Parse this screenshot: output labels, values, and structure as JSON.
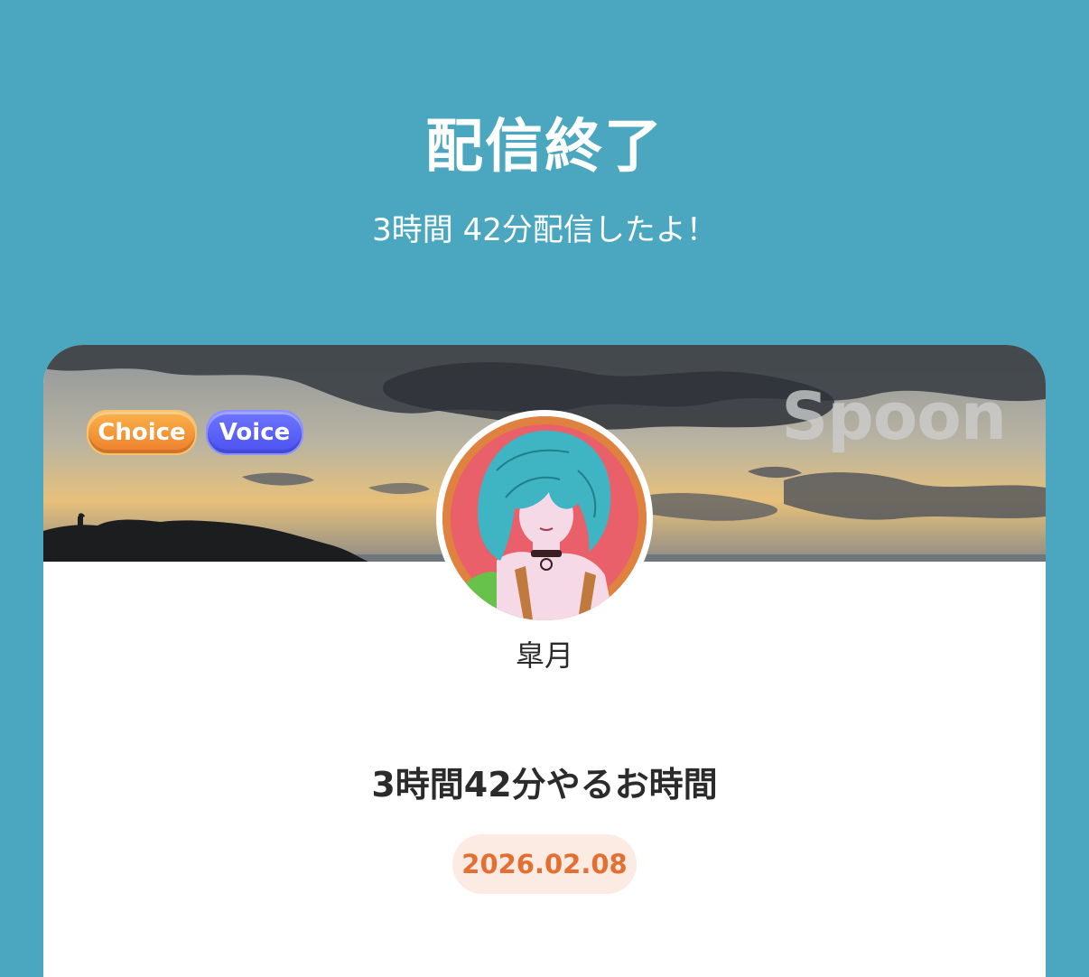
{
  "header": {
    "title": "配信終了",
    "subtitle": "3時間 42分配信したよ！"
  },
  "card": {
    "badges": {
      "choice": "Choice",
      "voice": "Voice"
    },
    "brand": "Spoon",
    "username": "皐月",
    "show_title": "3時間42分やるお時間",
    "date": "2026.02.08"
  },
  "colors": {
    "background": "#4ba7bf",
    "choice_badge": "#ee7f2c",
    "voice_badge": "#4b52f0",
    "date_text": "#e46f33",
    "date_pill": "#fbebe3"
  }
}
